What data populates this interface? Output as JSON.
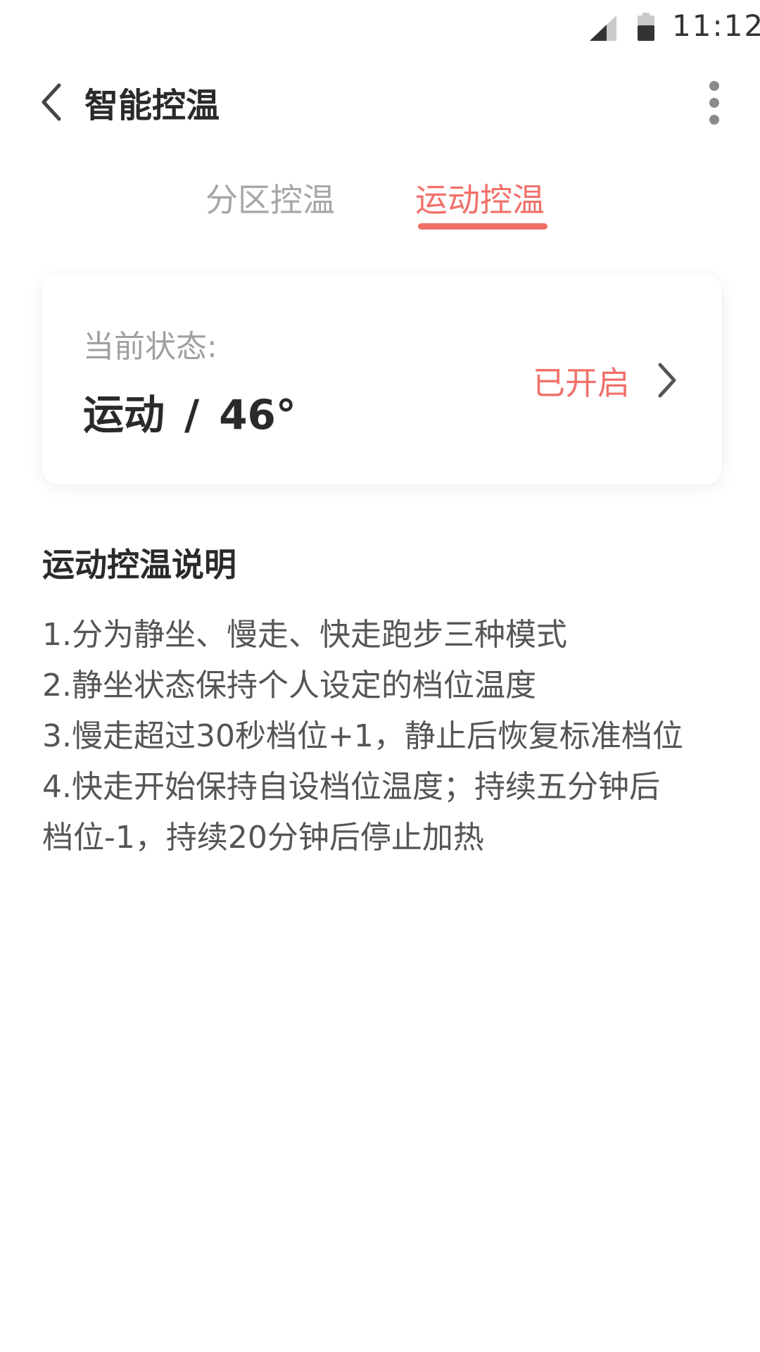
{
  "status_bar": {
    "time": "11:12",
    "icons": [
      "signal-icon",
      "battery-icon"
    ]
  },
  "header": {
    "title": "智能控温",
    "back_icon": "chevron-left-icon",
    "more_icon": "more-vertical-icon"
  },
  "tabs": [
    {
      "label": "分区控温",
      "active": false
    },
    {
      "label": "运动控温",
      "active": true
    }
  ],
  "status_card": {
    "label": "当前状态:",
    "mode": "运动",
    "separator": "/",
    "temperature": "46°",
    "state": "已开启",
    "chevron_icon": "chevron-right-icon"
  },
  "description": {
    "heading": "运动控温说明",
    "lines": [
      "1.分为静坐、慢走、快走跑步三种模式",
      "2.静坐状态保持个人设定的档位温度",
      "3.慢走超过30秒档位+1，静止后恢复标准档位",
      "4.快走开始保持自设档位温度；持续五分钟后",
      "档位-1，持续20分钟后停止加热"
    ]
  },
  "colors": {
    "accent": "#f1706a",
    "text_primary": "#2a2a2a",
    "text_secondary": "#a6a6a6",
    "text_body": "#555555"
  }
}
